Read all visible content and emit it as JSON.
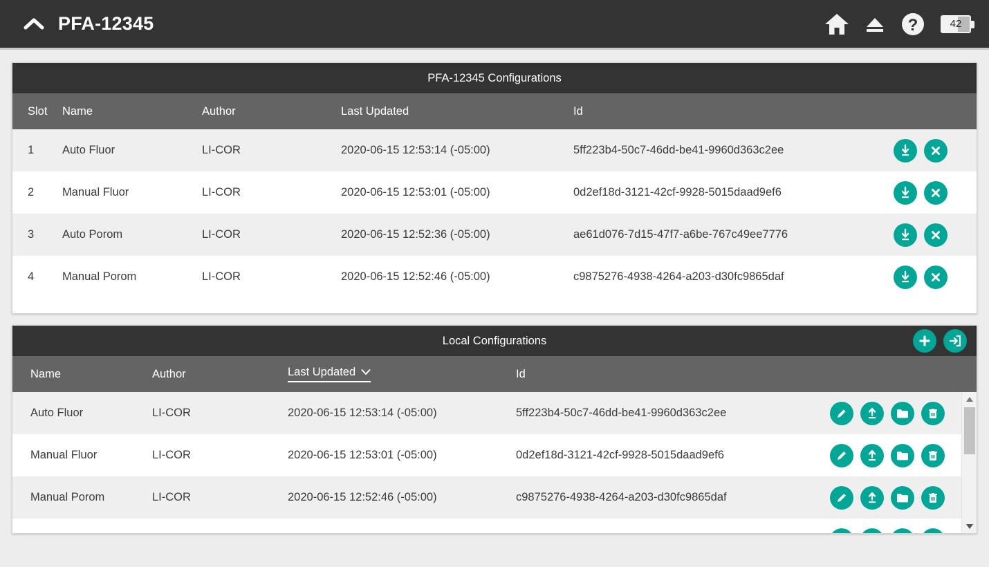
{
  "header": {
    "title": "PFA-12345",
    "collapse_icon": "chevron-up-icon",
    "icons": [
      {
        "name": "home-icon",
        "label": "Home"
      },
      {
        "name": "eject-icon",
        "label": "Eject"
      },
      {
        "name": "help-icon",
        "label": "Help"
      }
    ],
    "battery": {
      "level": "42"
    }
  },
  "device_configs": {
    "title": "PFA-12345 Configurations",
    "columns": [
      "Slot",
      "Name",
      "Author",
      "Last Updated",
      "Id"
    ],
    "rows": [
      {
        "slot": "1",
        "name": "Auto Fluor",
        "author": "LI-COR",
        "updated": "2020-06-15 12:53:14 (-05:00)",
        "id": "5ff223b4-50c7-46dd-be41-9960d363c2ee"
      },
      {
        "slot": "2",
        "name": "Manual Fluor",
        "author": "LI-COR",
        "updated": "2020-06-15 12:53:01 (-05:00)",
        "id": "0d2ef18d-3121-42cf-9928-5015daad9ef6"
      },
      {
        "slot": "3",
        "name": "Auto Porom",
        "author": "LI-COR",
        "updated": "2020-06-15 12:52:36 (-05:00)",
        "id": "ae61d076-7d15-47f7-a6be-767c49ee7776"
      },
      {
        "slot": "4",
        "name": "Manual Porom",
        "author": "LI-COR",
        "updated": "2020-06-15 12:52:46 (-05:00)",
        "id": "c9875276-4938-4264-a203-d30fc9865daf"
      }
    ],
    "row_actions": [
      {
        "name": "download-icon",
        "label": "Download"
      },
      {
        "name": "delete-x-icon",
        "label": "Remove"
      }
    ]
  },
  "local_configs": {
    "title": "Local Configurations",
    "header_actions": [
      {
        "name": "add-icon",
        "label": "New"
      },
      {
        "name": "import-icon",
        "label": "Import"
      }
    ],
    "columns": [
      "Name",
      "Author",
      "Last Updated",
      "Id"
    ],
    "sorted_column": "Last Updated",
    "sort_icon": "chevron-down-icon",
    "rows": [
      {
        "name": "Auto Fluor",
        "author": "LI-COR",
        "updated": "2020-06-15 12:53:14 (-05:00)",
        "id": "5ff223b4-50c7-46dd-be41-9960d363c2ee"
      },
      {
        "name": "Manual Fluor",
        "author": "LI-COR",
        "updated": "2020-06-15 12:53:01 (-05:00)",
        "id": "0d2ef18d-3121-42cf-9928-5015daad9ef6"
      },
      {
        "name": "Manual Porom",
        "author": "LI-COR",
        "updated": "2020-06-15 12:52:46 (-05:00)",
        "id": "c9875276-4938-4264-a203-d30fc9865daf"
      }
    ],
    "row_actions": [
      {
        "name": "edit-pencil-icon",
        "label": "Edit"
      },
      {
        "name": "upload-icon",
        "label": "Upload"
      },
      {
        "name": "folder-icon",
        "label": "Open"
      },
      {
        "name": "trash-icon",
        "label": "Delete"
      }
    ],
    "scrollbar": {
      "up_icon": "triangle-up-icon",
      "down_icon": "triangle-down-icon"
    }
  },
  "colors": {
    "accent": "#00a796",
    "title_bar": "#333333",
    "column_header": "#646464",
    "row_alt": "#efefef",
    "page_bg": "#ededed"
  }
}
